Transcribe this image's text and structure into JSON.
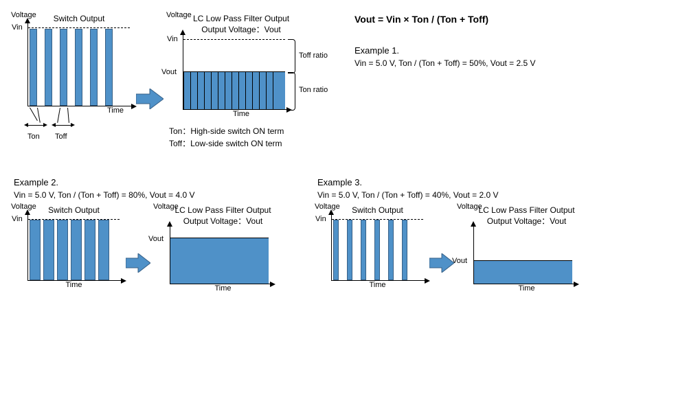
{
  "formula": "Vout = Vin × Ton / (Ton + Toff)",
  "labels": {
    "voltage": "Voltage",
    "time": "Time",
    "vin": "Vin",
    "vout": "Vout",
    "switch_output": "Switch Output",
    "lc_output_line1": "LC Low Pass Filter Output",
    "lc_output_line2": "Output Voltage：Vout",
    "ton": "Ton",
    "toff": "Toff",
    "ton_ratio": "Ton ratio",
    "toff_ratio": "Toff ratio",
    "ton_desc": "Ton：High-side switch ON term",
    "toff_desc": "Toff：Low-side switch ON term"
  },
  "example1": {
    "title": "Example 1.",
    "params": "Vin = 5.0 V, Ton / (Ton + Toff) = 50%,   Vout = 2.5 V"
  },
  "example2": {
    "title": "Example 2.",
    "params": "Vin = 5.0 V, Ton / (Ton + Toff) = 80%,   Vout = 4.0 V"
  },
  "example3": {
    "title": "Example 3.",
    "params": "Vin = 5.0 V, Ton / (Ton + Toff) = 40%,   Vout = 2.0 V"
  },
  "chart_data": [
    {
      "type": "bar",
      "title": "Switch Output (Example 1, 50% duty)",
      "xlabel": "Time",
      "ylabel": "Voltage",
      "ylim": [
        0,
        5.0
      ],
      "pulses": 6,
      "duty_cycle": 0.5,
      "amplitude": 5.0
    },
    {
      "type": "bar",
      "title": "LC Low Pass Filter Output (Example 1)",
      "xlabel": "Time",
      "ylabel": "Voltage",
      "ylim": [
        0,
        5.0
      ],
      "constant_value": 2.5
    },
    {
      "type": "bar",
      "title": "Switch Output (Example 2, 80% duty)",
      "xlabel": "Time",
      "ylabel": "Voltage",
      "ylim": [
        0,
        5.0
      ],
      "pulses": 6,
      "duty_cycle": 0.8,
      "amplitude": 5.0
    },
    {
      "type": "bar",
      "title": "LC Low Pass Filter Output (Example 2)",
      "xlabel": "Time",
      "ylabel": "Voltage",
      "ylim": [
        0,
        5.0
      ],
      "constant_value": 4.0
    },
    {
      "type": "bar",
      "title": "Switch Output (Example 3, 40% duty)",
      "xlabel": "Time",
      "ylabel": "Voltage",
      "ylim": [
        0,
        5.0
      ],
      "pulses": 6,
      "duty_cycle": 0.4,
      "amplitude": 5.0
    },
    {
      "type": "bar",
      "title": "LC Low Pass Filter Output (Example 3)",
      "xlabel": "Time",
      "ylabel": "Voltage",
      "ylim": [
        0,
        5.0
      ],
      "constant_value": 2.0
    }
  ]
}
